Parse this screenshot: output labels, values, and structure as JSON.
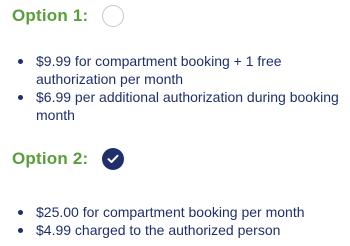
{
  "options": [
    {
      "title": "Option 1:",
      "selected": false,
      "bullets": [
        "$9.99 for compartment booking + 1 free authorization per month",
        "$6.99 per additional authorization during booking month"
      ]
    },
    {
      "title": "Option 2:",
      "selected": true,
      "bullets": [
        "$25.00 for compartment booking per month",
        "$4.99 charged to the authorized person"
      ]
    }
  ],
  "colors": {
    "title_green": "#5a9e3c",
    "text_navy": "#1f2f6b",
    "radio_border": "#c8c8c8"
  },
  "icons": {
    "selected_radio": "checkmark-icon"
  }
}
